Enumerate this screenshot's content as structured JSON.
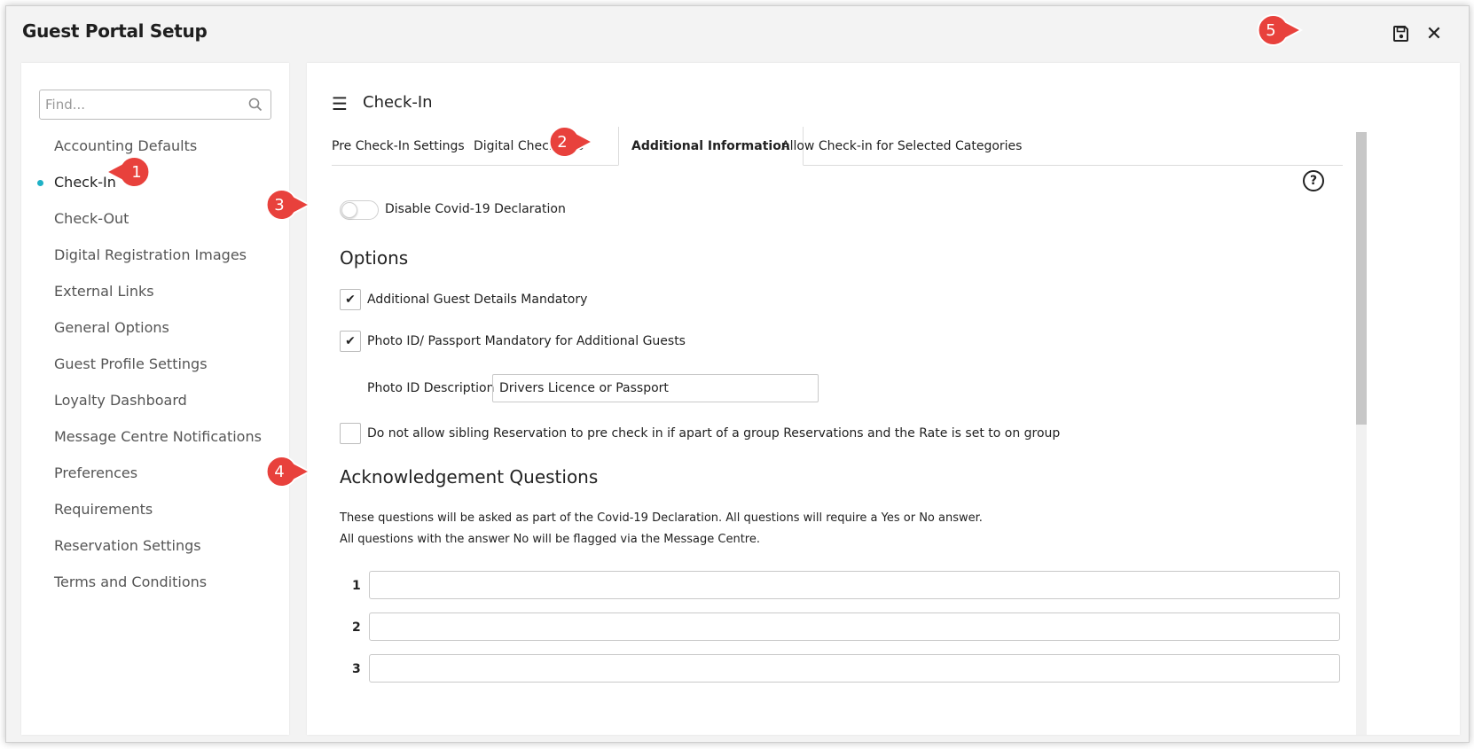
{
  "window": {
    "title": "Guest Portal Setup"
  },
  "toolbar": {
    "save_icon": "save-icon",
    "close_label": "✕"
  },
  "sidebar": {
    "search_placeholder": "Find...",
    "items": [
      {
        "label": "Accounting Defaults"
      },
      {
        "label": "Check-In",
        "active": true
      },
      {
        "label": "Check-Out"
      },
      {
        "label": "Digital Registration Images"
      },
      {
        "label": "External Links"
      },
      {
        "label": "General Options"
      },
      {
        "label": "Guest Profile Settings"
      },
      {
        "label": "Loyalty Dashboard"
      },
      {
        "label": "Message Centre Notifications"
      },
      {
        "label": "Preferences"
      },
      {
        "label": "Requirements"
      },
      {
        "label": "Reservation Settings"
      },
      {
        "label": "Terms and Conditions"
      }
    ]
  },
  "main": {
    "section_title": "Check-In",
    "tabs": [
      {
        "label": "Pre Check-In Settings"
      },
      {
        "label": "Digital Check-In S"
      },
      {
        "label": "Additional Information",
        "active": true
      },
      {
        "label": "Allow Check-in for Selected Categories"
      }
    ],
    "help_label": "?",
    "covid_toggle": {
      "label": "Disable Covid-19 Declaration",
      "on": false
    },
    "options": {
      "title": "Options",
      "guest_details": {
        "label": "Additional Guest Details Mandatory",
        "checked": true
      },
      "photo_id": {
        "label": "Photo ID/ Passport Mandatory for Additional Guests",
        "checked": true
      },
      "photo_desc": {
        "label": "Photo ID Description",
        "value": "Drivers Licence or Passport"
      },
      "sibling": {
        "label": "Do not allow sibling Reservation to pre check in if apart of a group Reservations and the Rate is set to on group",
        "checked": false
      }
    },
    "ack": {
      "title": "Acknowledgement Questions",
      "line1": "These questions will be asked as part of the Covid-19 Declaration. All questions will require a Yes or No answer.",
      "line2": "All questions with the answer No will be flagged via the Message Centre.",
      "questions": [
        {
          "num": "1",
          "value": ""
        },
        {
          "num": "2",
          "value": ""
        },
        {
          "num": "3",
          "value": ""
        }
      ]
    }
  },
  "callouts": [
    "1",
    "2",
    "3",
    "4",
    "5"
  ],
  "colors": {
    "accent": "#1fb1c6",
    "callout": "#e8413c"
  }
}
